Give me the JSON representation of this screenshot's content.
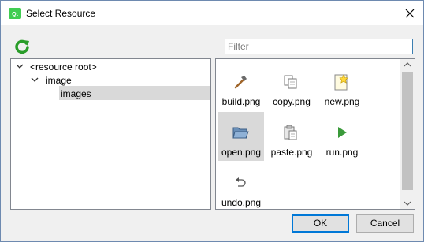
{
  "window": {
    "title": "Select Resource"
  },
  "filter": {
    "placeholder": "Filter",
    "value": ""
  },
  "tree": {
    "items": [
      {
        "label": "<resource root>",
        "expanded": true
      },
      {
        "label": "image",
        "expanded": true
      },
      {
        "label": "images",
        "selected": true
      }
    ]
  },
  "files": [
    {
      "name": "build.png",
      "icon": "hammer-icon"
    },
    {
      "name": "copy.png",
      "icon": "copy-icon"
    },
    {
      "name": "new.png",
      "icon": "new-file-icon"
    },
    {
      "name": "open.png",
      "icon": "folder-open-icon",
      "selected": true
    },
    {
      "name": "paste.png",
      "icon": "paste-icon"
    },
    {
      "name": "run.png",
      "icon": "play-icon"
    },
    {
      "name": "undo.png",
      "icon": "undo-icon"
    }
  ],
  "buttons": {
    "ok": "OK",
    "cancel": "Cancel"
  },
  "colors": {
    "accent": "#0078d7",
    "selection": "#d9d9d9",
    "reload": "#2a9d2a",
    "run": "#3a9a3a"
  }
}
